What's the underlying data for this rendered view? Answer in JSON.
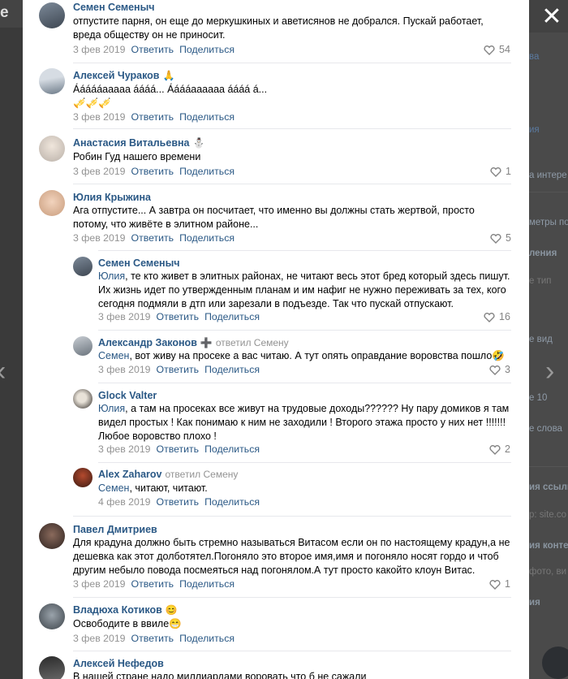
{
  "background": {
    "left_letter": "e",
    "right_items": [
      "ва",
      "ия",
      "а интере",
      "метры по",
      "ления",
      "е тип",
      "е вид",
      "е 10",
      "е слова",
      "ия ссылк",
      "p: site.co",
      "ия конте",
      "фото, ви",
      "ия"
    ]
  },
  "colors": {
    "link": "#2a5885",
    "date": "#939393",
    "like": "#828282",
    "separator": "#e7e8ec"
  },
  "icons": {
    "close": "close-icon",
    "prev": "chevron-left-icon",
    "next": "chevron-right-icon",
    "like": "heart-icon"
  },
  "actions": {
    "reply": "Ответить",
    "share": "Поделиться"
  },
  "comments": [
    {
      "author": "Семен Семеныч",
      "emoji": "",
      "replied": "",
      "reply_to": "",
      "text": "отпустите парня, он еще до меркушкиных и аветисянов не добрался. Пускай работает, вреда обществу он не приносит.",
      "extra": "",
      "date": "3 фев 2019",
      "likes": "54"
    },
    {
      "author": "Алексей Чураков",
      "emoji": "🙏",
      "replied": "",
      "reply_to": "",
      "text": "Áááááaaaaa áááá... Ááááaaaaaa áááá á...",
      "extra": "🎺🎺🎺",
      "date": "3 фев 2019",
      "likes": ""
    },
    {
      "author": "Анастасия Витальевна",
      "emoji": "⛄",
      "replied": "",
      "reply_to": "",
      "text": "Робин Гуд нашего времени",
      "extra": "",
      "date": "3 фев 2019",
      "likes": "1"
    },
    {
      "author": "Юлия Крыжина",
      "emoji": "",
      "replied": "",
      "reply_to": "",
      "text": "Ага отпустите... А завтра он посчитает, что именно вы должны стать жертвой, просто потому, что живёте в элитном районе...",
      "extra": "",
      "date": "3 фев 2019",
      "likes": "5"
    },
    {
      "author": "Семен Семеныч",
      "emoji": "",
      "replied": "",
      "reply_to": "Юлия",
      "text": ", те кто живет в элитных районах, не читают весь этот бред который здесь пишут. Их жизнь идет по утвержденным планам и им нафиг не нужно переживать за тех, кого сегодня подмяли в дтп или зарезали в подъезде. Так что пускай отпускают.",
      "extra": "",
      "date": "3 фев 2019",
      "likes": "16"
    },
    {
      "author": "Александр Законов",
      "emoji": "➕",
      "replied": "ответил Семену",
      "reply_to": "Семен",
      "text": ", вот живу на просеке а вас читаю. А тут опять оправдание воровства пошло🤣",
      "extra": "",
      "date": "3 фев 2019",
      "likes": "3"
    },
    {
      "author": "Glock Valter",
      "emoji": "",
      "replied": "",
      "reply_to": "Юлия",
      "text": ", а там на просеках все живут на трудовые доходы?????? Ну пару домиков я там видел простых ! Как понимаю к ним не заходили ! Второго этажа просто у них нет !!!!!!! Любое воровство плохо !",
      "extra": "",
      "date": "3 фев 2019",
      "likes": "2"
    },
    {
      "author": "Alex Zaharov",
      "emoji": "",
      "replied": "ответил Семену",
      "reply_to": "Семен",
      "text": ", читают, читают.",
      "extra": "",
      "date": "4 фев 2019",
      "likes": ""
    },
    {
      "author": "Павел Дмитриев",
      "emoji": "",
      "replied": "",
      "reply_to": "",
      "text": "Для крадуна должно быть стремно называться Витасом если он по настоящему крадун,а не дешевка как этот долботятел.Погоняло это второе имя,имя и погоняло носят гордо и чтоб другим небыло повода посмеяться над погонялом.А тут просто какойто клоун Витас.",
      "extra": "",
      "date": "3 фев 2019",
      "likes": "1"
    },
    {
      "author": "Владюха Котиков",
      "emoji": "😊",
      "replied": "",
      "reply_to": "",
      "text": "Освободите в ввиле😁",
      "extra": "",
      "date": "3 фев 2019",
      "likes": ""
    },
    {
      "author": "Алексей Нефедов",
      "emoji": "",
      "replied": "",
      "reply_to": "",
      "text": "В нашей стране надо миллиардами воровать что б не сажали",
      "extra": "",
      "date": "",
      "likes": ""
    }
  ]
}
